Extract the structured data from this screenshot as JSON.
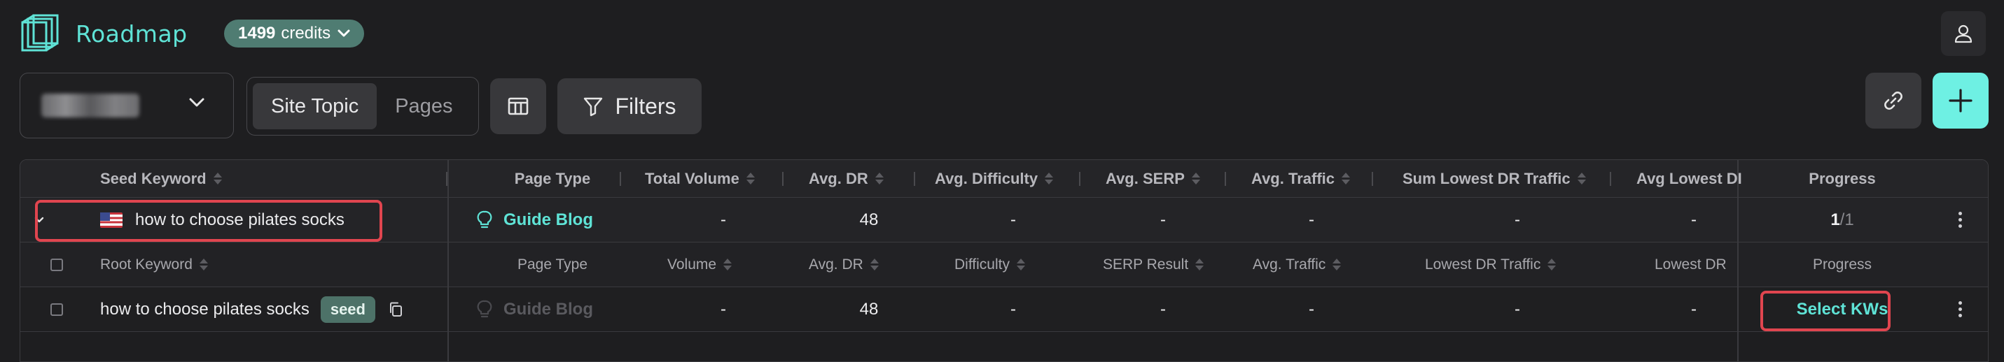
{
  "app": {
    "name": "Roadmap"
  },
  "credits": {
    "count": "1499",
    "label": "credits"
  },
  "toolbar": {
    "segments": [
      {
        "label": "Site Topic",
        "active": true
      },
      {
        "label": "Pages",
        "active": false
      }
    ],
    "filters_label": "Filters"
  },
  "table": {
    "header": {
      "seed_keyword": "Seed Keyword",
      "page_type": "Page Type",
      "total_volume": "Total Volume",
      "avg_dr": "Avg. DR",
      "avg_difficulty": "Avg. Difficulty",
      "avg_serp": "Avg. SERP",
      "avg_traffic": "Avg. Traffic",
      "sum_lowest_dr_traffic": "Sum Lowest DR Traffic",
      "avg_lowest_dr": "Avg Lowest DI",
      "progress": "Progress"
    },
    "group": {
      "keyword": "how to choose pilates socks",
      "page_type": "Guide Blog",
      "total_volume": "-",
      "avg_dr": "48",
      "avg_difficulty": "-",
      "avg_serp": "-",
      "avg_traffic": "-",
      "sum_lowest_dr_traffic": "-",
      "avg_lowest_dr": "-",
      "progress_done": "1",
      "progress_total": "/1"
    },
    "subheader": {
      "root_keyword": "Root Keyword",
      "page_type": "Page Type",
      "volume": "Volume",
      "avg_dr": "Avg. DR",
      "difficulty": "Difficulty",
      "serp_result": "SERP Result",
      "avg_traffic": "Avg. Traffic",
      "lowest_dr_traffic": "Lowest DR Traffic",
      "lowest_dr": "Lowest DR",
      "progress": "Progress"
    },
    "rows": [
      {
        "keyword": "how to choose pilates socks",
        "badge": "seed",
        "page_type": "Guide Blog",
        "volume": "-",
        "avg_dr": "48",
        "difficulty": "-",
        "serp_result": "-",
        "avg_traffic": "-",
        "lowest_dr_traffic": "-",
        "lowest_dr": "-",
        "action": "Select KWs"
      }
    ]
  },
  "colors": {
    "accent": "#5fe3d6",
    "highlight": "#e0454f",
    "badge": "#4d7268",
    "credits_bg": "#4f7c72"
  }
}
